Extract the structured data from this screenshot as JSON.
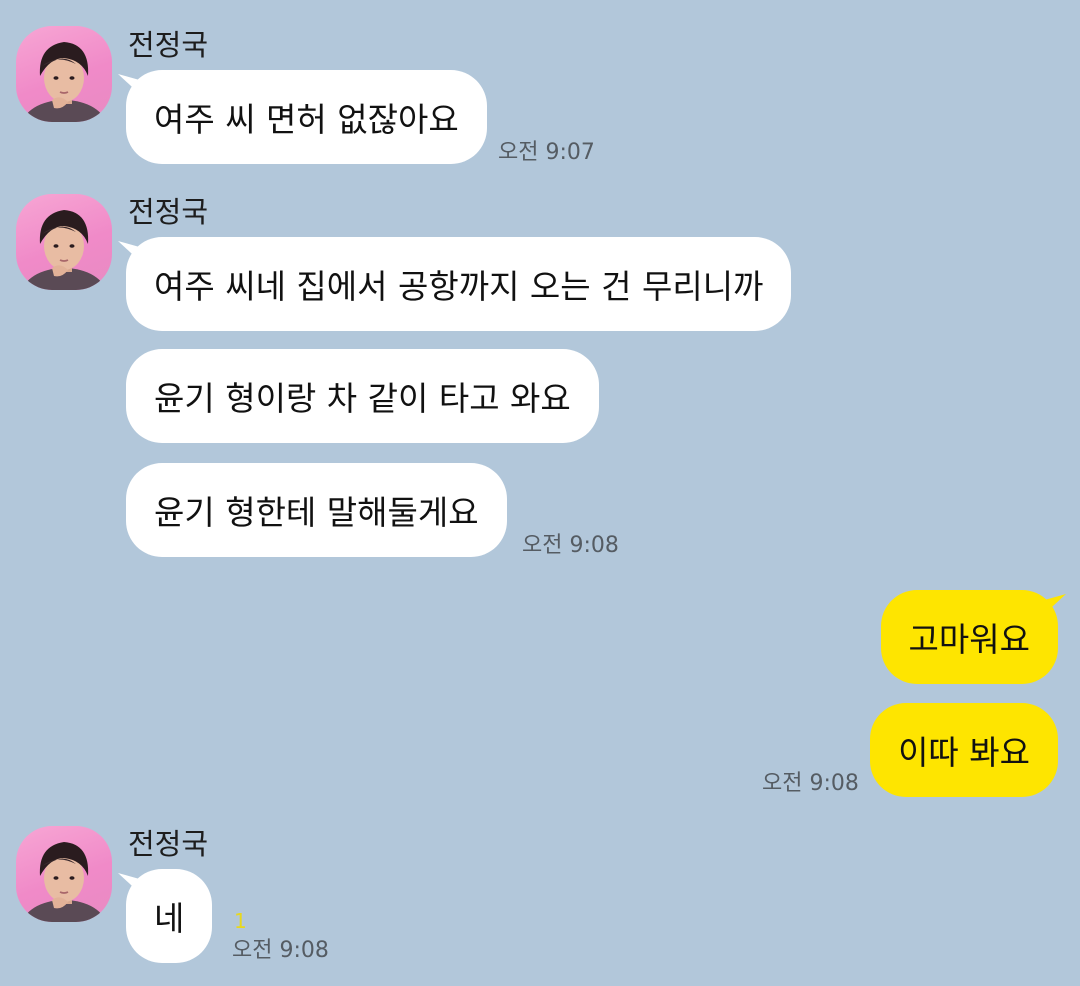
{
  "chat": {
    "sender_name": "전정국",
    "messages": [
      {
        "text": "여주 씨 면허 없잖아요"
      },
      {
        "text": "여주 씨네 집에서 공항까지 오는 건 무리니까"
      },
      {
        "text": "윤기 형이랑 차 같이 타고 와요"
      },
      {
        "text": "윤기 형한테 말해둘게요"
      },
      {
        "text": "고마워요"
      },
      {
        "text": "이따 봐요"
      },
      {
        "text": "네"
      }
    ],
    "times": {
      "t1": "오전 9:07",
      "t2": "오전 9:08",
      "t3": "오전 9:08",
      "t4": "오전 9:08"
    },
    "unread_count": "1"
  },
  "colors": {
    "background": "#b2c7da",
    "incoming_bubble": "#ffffff",
    "outgoing_bubble": "#fee500",
    "unread": "#e8d81c"
  }
}
